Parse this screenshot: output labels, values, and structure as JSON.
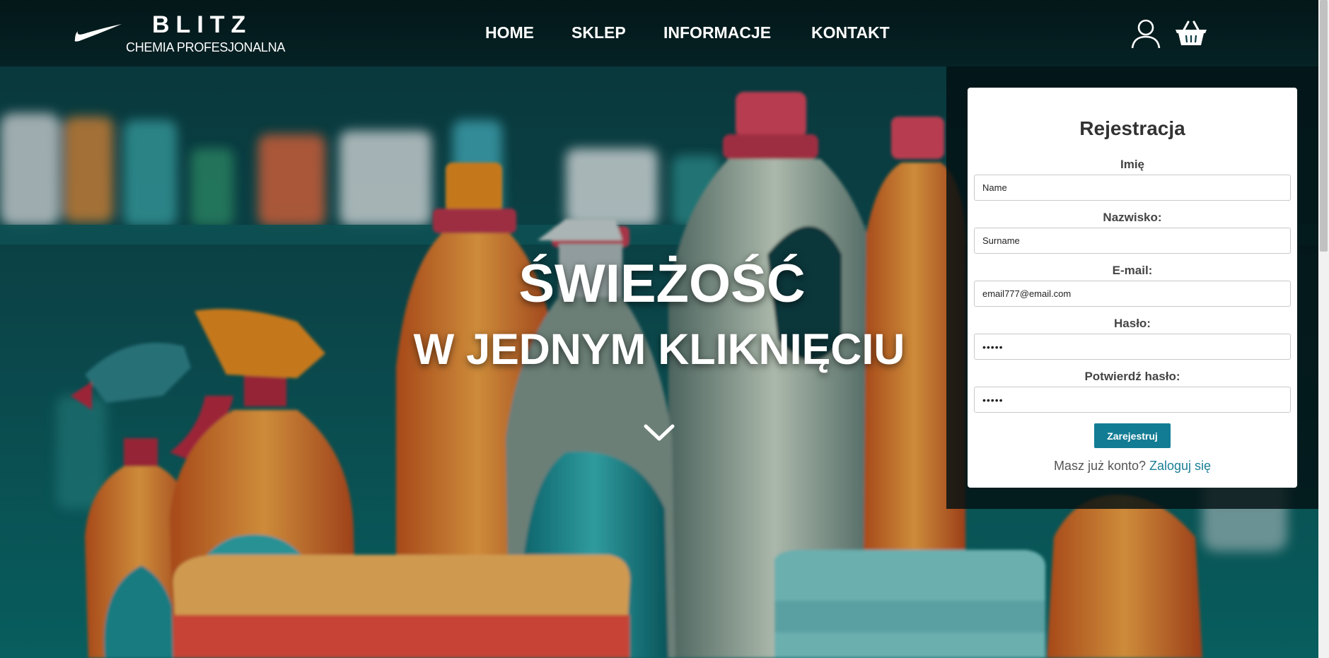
{
  "brand": {
    "title": "BLITZ",
    "subtitle": "CHEMIA PROFESJONALNA",
    "logo_icon": "swoosh-logo"
  },
  "nav": {
    "items": [
      {
        "label": "HOME"
      },
      {
        "label": "SKLEP"
      },
      {
        "label": "INFORMACJE"
      },
      {
        "label": "KONTAKT"
      }
    ],
    "icons": [
      "user-icon",
      "cart-icon"
    ]
  },
  "hero": {
    "title": "ŚWIEŻOŚĆ",
    "subtitle": "W JEDNYM KLIKNIĘCIU",
    "scroll_icon": "chevron-down-icon"
  },
  "form": {
    "title": "Rejestracja",
    "fields": [
      {
        "label": "Imię",
        "value": "Name"
      },
      {
        "label": "Nazwisko:",
        "value": "Surname"
      },
      {
        "label": "E-mail:",
        "value": "email777@email.com"
      },
      {
        "label": "Hasło:",
        "value": "•••••"
      },
      {
        "label": "Potwierdź hasło:",
        "value": "•••••"
      }
    ],
    "submit_label": "Zarejestruj",
    "login_prompt": "Masz już konto?",
    "login_link": "Zaloguj się"
  },
  "colors": {
    "accent": "#127c94",
    "link": "#1a7f95",
    "header_bg": "#051e20"
  }
}
